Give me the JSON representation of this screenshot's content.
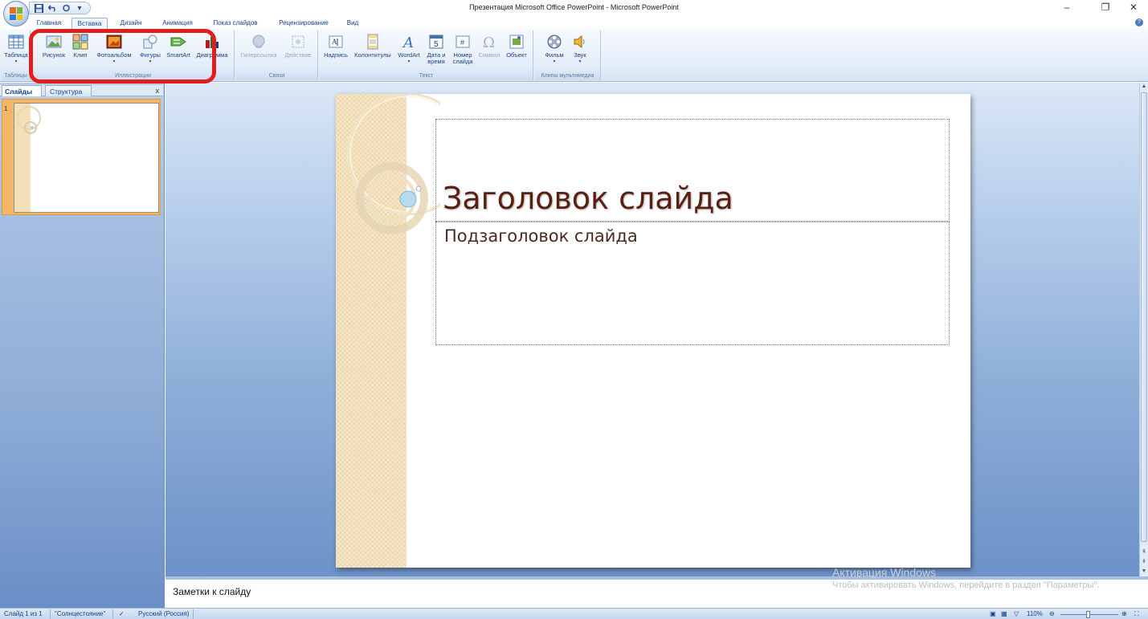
{
  "window": {
    "title": "Презентация Microsoft Office PowerPoint - Microsoft PowerPoint",
    "minimize_glyph": "–",
    "restore_glyph": "❐",
    "close_glyph": "✕"
  },
  "quick_access": {
    "save_icon": "save-icon",
    "undo_icon": "undo-icon",
    "redo_icon": "redo-icon",
    "customize_glyph": "▾"
  },
  "tabs": [
    {
      "label": "Главная"
    },
    {
      "label": "Вставка",
      "active": true
    },
    {
      "label": "Дизайн"
    },
    {
      "label": "Анимация"
    },
    {
      "label": "Показ слайдов"
    },
    {
      "label": "Рецензирование"
    },
    {
      "label": "Вид"
    }
  ],
  "ribbon": {
    "groups": {
      "tables": "Таблицы",
      "illustrations": "Иллюстрации",
      "links": "Связи",
      "text": "Текст",
      "media": "Клипы мультимедиа"
    },
    "buttons": {
      "table": "Таблица",
      "picture": "Рисунок",
      "clip": "Клип",
      "photo_album": "Фотоальбом",
      "shapes": "Фигуры",
      "smartart": "SmartArt",
      "chart": "Диаграмма",
      "hyperlink": "Гиперссылка",
      "action": "Действие",
      "textbox": "Надпись",
      "header_footer": "Колонтитулы",
      "wordart": "WordArt",
      "datetime_1": "Дата и",
      "datetime_2": "время",
      "slide_number_1": "Номер",
      "slide_number_2": "слайда",
      "symbol": "Символ",
      "object": "Объект",
      "movie": "Фильм",
      "sound": "Звук"
    },
    "dropdown_glyph": "▾"
  },
  "left_panel": {
    "tab_slides": "Слайды",
    "tab_outline": "Структура",
    "close_glyph": "x",
    "thumb_number": "1"
  },
  "slide": {
    "title": "Заголовок слайда",
    "subtitle": "Подзаголовок слайда"
  },
  "notes": {
    "text": "Заметки к слайду"
  },
  "watermark": {
    "line1": "Активация Windows",
    "line2": "Чтобы активировать Windows, перейдите в раздел \"Параметры\"."
  },
  "status": {
    "slide_info": "Слайд 1 из 1",
    "theme": "\"Солнцестояние\"",
    "language": "Русский (Россия)",
    "zoom": "110%"
  },
  "colors": {
    "highlight": "#e01e1e",
    "thumb_selection": "#f5b567",
    "slide_title": "#5a1f10"
  }
}
